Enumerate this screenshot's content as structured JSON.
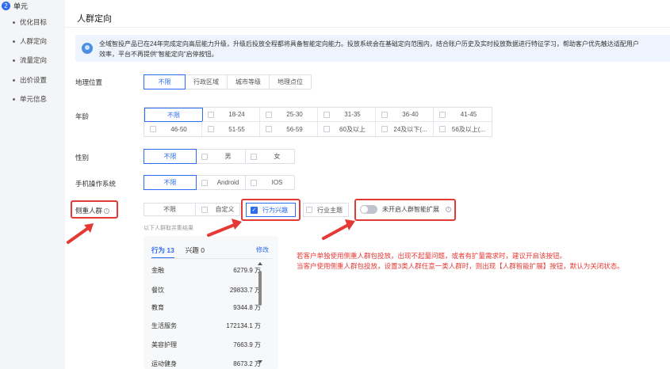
{
  "sidebar": {
    "step_number": "2",
    "step_label": "单元",
    "items": [
      {
        "label": "优化目标"
      },
      {
        "label": "人群定向"
      },
      {
        "label": "流量定向"
      },
      {
        "label": "出价设置"
      },
      {
        "label": "单元信息"
      }
    ]
  },
  "page": {
    "title": "人群定向",
    "notice": "全域智投产品已在24年完成定向高层能力升级，升级后投放全程都将具备智能定向能力。投放系统会在基础定向范围内，结合账户历史及实时投放数据进行特征学习，帮助客户优先触达适配用户",
    "notice_line2": "效率，平台不再提供\"智能定向\"启停按钮。"
  },
  "location": {
    "label": "地理位置",
    "options": [
      "不限",
      "行政区域",
      "城市等级",
      "地理点位"
    ]
  },
  "age": {
    "label": "年龄",
    "options": [
      "不限",
      "18-24",
      "25-30",
      "31-35",
      "36-40",
      "41-45",
      "46-50",
      "51-55",
      "56-59",
      "60及以上",
      "24及以下(...",
      "56及以上(..."
    ]
  },
  "gender": {
    "label": "性别",
    "options": [
      "不限",
      "男",
      "女"
    ]
  },
  "os": {
    "label": "手机操作系统",
    "options": [
      "不限",
      "Android",
      "IOS"
    ]
  },
  "audience": {
    "label": "侧重人群",
    "options": [
      "不限",
      "自定义",
      "行为兴趣",
      "行业主题"
    ],
    "toggle_label": "未开启人群智能扩展",
    "hint": "以下人群取并集结果"
  },
  "panel": {
    "tab_behavior": "行为 13",
    "tab_interest": "兴趣 0",
    "edit": "修改",
    "rows": [
      {
        "name": "金融",
        "value": "6279.9 万"
      },
      {
        "name": "餐饮",
        "value": "29833.7 万"
      },
      {
        "name": "教育",
        "value": "9344.8 万"
      },
      {
        "name": "生活服务",
        "value": "172134.1 万"
      },
      {
        "name": "美容护理",
        "value": "7663.9 万"
      },
      {
        "name": "运动健身",
        "value": "8673.2 万"
      }
    ]
  },
  "annotation": {
    "line1": "若客户单独使用侧重人群包投放，出现不起量问题，或者有扩量需求时，建议开启该按钮。",
    "line2": "当客户使用侧重人群包投放，设置3类人群任意一类人群时，则出现【人群智能扩展】按钮，默认为关闭状态。"
  },
  "colors": {
    "accent": "#2c6cf0",
    "highlight": "#e53935"
  }
}
